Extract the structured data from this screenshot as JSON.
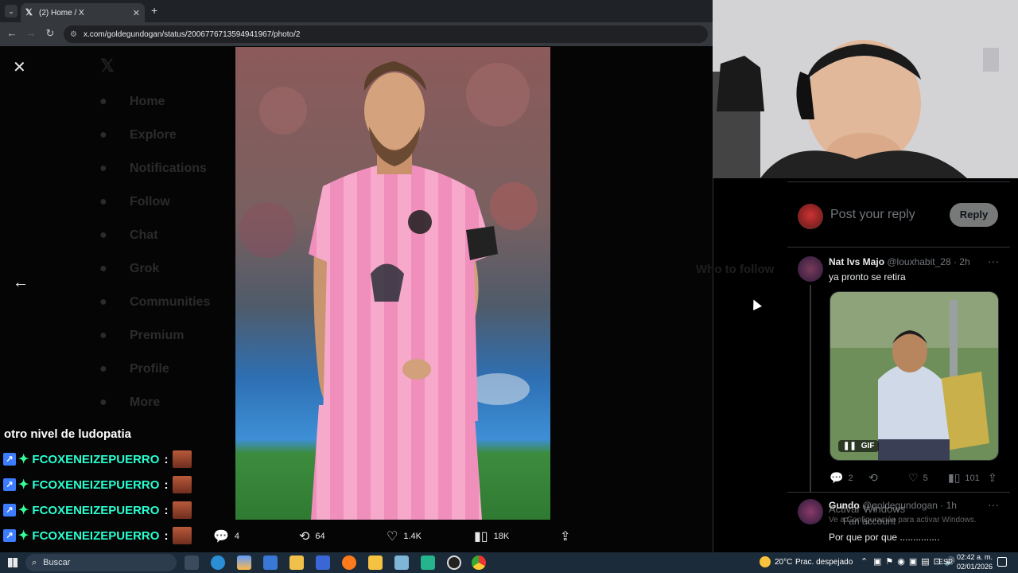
{
  "browser": {
    "tab_title": "(2) Home / X",
    "new_tab": "+",
    "url": "x.com/goldegundogan/status/2006776713594941967/photo/2"
  },
  "viewer": {
    "close_icon": "close-icon",
    "prev_icon": "arrow-left-icon",
    "ghost_nav": [
      "Home",
      "Explore",
      "Notifications",
      "Follow",
      "Chat",
      "Grok",
      "Communities",
      "Premium",
      "Profile",
      "More"
    ],
    "actions": {
      "replies": "4",
      "reposts": "64",
      "likes": "1.4K",
      "views": "18K"
    }
  },
  "chat": {
    "title": "otro nivel de ludopatia",
    "lines": [
      {
        "user": "FCOXENEIZEPUERRO",
        "sep": ":"
      },
      {
        "user": "FCOXENEIZEPUERRO",
        "sep": ":"
      },
      {
        "user": "FCOXENEIZEPUERRO",
        "sep": ":"
      },
      {
        "user": "FCOXENEIZEPUERRO",
        "sep": ":"
      }
    ]
  },
  "panel": {
    "reply_placeholder": "Post your reply",
    "reply_button": "Reply",
    "ghost_right": [
      "Who to follow"
    ],
    "comments": [
      {
        "name": "Nat lvs Majo",
        "handle": "@louxhabit_28",
        "time": "· 2h",
        "text": "ya pronto se retira",
        "gif_badge": "GIF",
        "stats": {
          "replies": "2",
          "reposts": "",
          "likes": "5",
          "views": "101"
        }
      },
      {
        "name": "Gundo",
        "handle": "@goldegundogan",
        "time": "· 1h",
        "sub": "Fan account",
        "text": "Por que por que ..............."
      }
    ],
    "windows_watermark": {
      "title": "Activar Windows",
      "body": "Ve a Configuración para activar Windows."
    }
  },
  "taskbar": {
    "search_placeholder": "Buscar",
    "weather": "20°C",
    "weather_desc": "Prac. despejado",
    "lang": "ESP",
    "time": "02:42 a. m.",
    "date": "02/01/2026"
  },
  "colors": {
    "x_bg": "#000000",
    "chat_name": "#29ffd0",
    "jersey_pink": "#f5a3c7"
  }
}
